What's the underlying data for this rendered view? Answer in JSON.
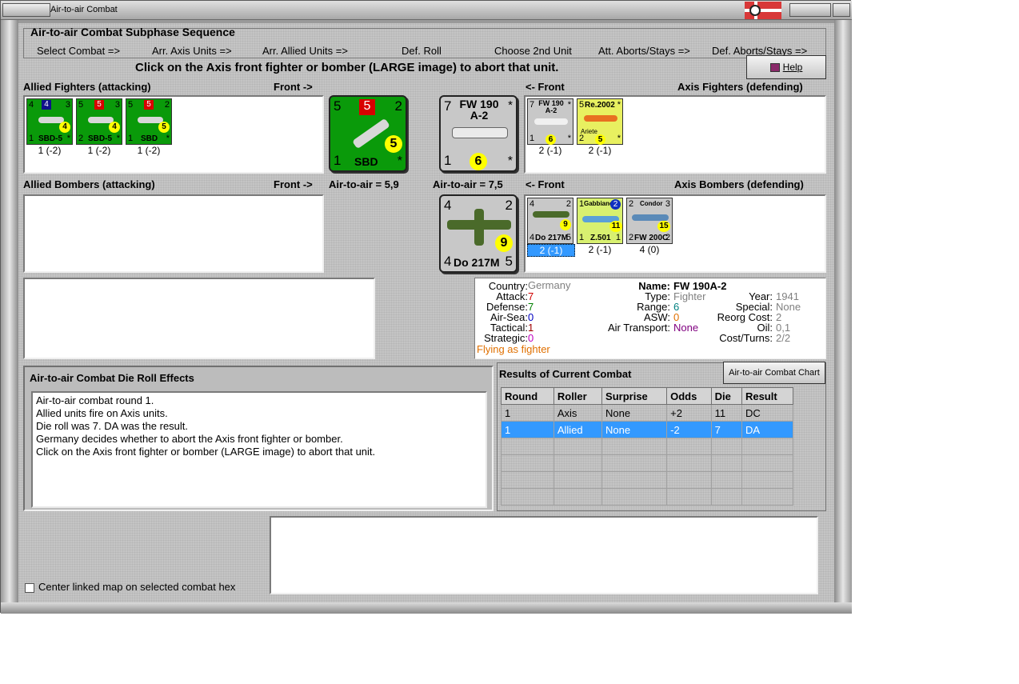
{
  "window": {
    "title": "Air-to-air Combat"
  },
  "sequence": {
    "title": "Air-to-air Combat Subphase Sequence",
    "steps": [
      "Select Combat =>",
      "Arr. Axis Units =>",
      "Arr. Allied Units =>",
      "Def. Roll",
      "Choose 2nd Unit",
      "Att. Aborts/Stays =>",
      "Def. Aborts/Stays =>"
    ]
  },
  "instruction": "Click on the Axis front fighter or bomber  (LARGE image) to abort that unit.",
  "help_label": "Help",
  "allied_fighters": {
    "title": "Allied Fighters (attacking)",
    "front": "Front ->",
    "units": [
      {
        "name": "SBD-5",
        "tl": "4",
        "tr": "3",
        "badge": "4",
        "bl": "1",
        "br": "*",
        "val": "4",
        "caption": "1 (-2)"
      },
      {
        "name": "SBD-5",
        "tl": "5",
        "tr": "3",
        "badge": "5",
        "bl": "2",
        "br": "*",
        "val": "4",
        "caption": "1 (-2)"
      },
      {
        "name": "SBD",
        "tl": "5",
        "tr": "2",
        "badge": "5",
        "bl": "1",
        "br": "*",
        "val": "5",
        "caption": "1 (-2)"
      }
    ]
  },
  "allied_bombers": {
    "title": "Allied Bombers (attacking)",
    "front": "Front ->"
  },
  "allied_big": {
    "tl": "5",
    "badge": "5",
    "tr": "2",
    "bl": "1",
    "name": "SBD",
    "val": "5",
    "br": "*"
  },
  "allied_a2a": "Air-to-air = 5,9",
  "axis_big_fighter": {
    "tl": "7",
    "name1": "FW 190",
    "name2": "A-2",
    "tr": "*",
    "bl": "1",
    "val": "6",
    "br": "*"
  },
  "axis_a2a": "Air-to-air = 7,5",
  "axis_big_bomber": {
    "tl": "4",
    "tr": "2",
    "val": "9",
    "bl": "4",
    "name": "Do 217M",
    "br": "5"
  },
  "axis_fighters": {
    "title": "Axis Fighters (defending)",
    "front": "<- Front",
    "units": [
      {
        "tl": "7",
        "name": "FW 190 A-2",
        "tr": "*",
        "bl": "1",
        "val": "6",
        "br": "*",
        "caption": "2 (-1)"
      },
      {
        "tl": "5",
        "name": "Re.2002",
        "sub": "Ariete",
        "tr": "*",
        "bl": "2",
        "val": "5",
        "br": "*",
        "caption": "2 (-1)"
      }
    ]
  },
  "axis_bombers": {
    "title": "Axis Bombers (defending)",
    "front": "<- Front",
    "units": [
      {
        "tl": "4",
        "tr": "2",
        "val": "9",
        "bl": "4",
        "name": "Do 217M",
        "br": "5",
        "caption": "2 (-1)"
      },
      {
        "tl": "1",
        "name": "Gabbiano",
        "badge": "2",
        "val": "11",
        "bl": "1",
        "bname": "Z.501",
        "br": "1",
        "caption": "2 (-1)"
      },
      {
        "tl": "2",
        "name": "Condor",
        "tr": "3",
        "val": "15",
        "bl": "2",
        "bname": "FW 200C",
        "br": "2",
        "caption": "4 (0)"
      }
    ]
  },
  "unit_info": {
    "country_label": "Country:",
    "country": "Germany",
    "attack_label": "Attack:",
    "attack": "7",
    "defense_label": "Defense:",
    "defense": "7",
    "airsea_label": "Air-Sea:",
    "airsea": "0",
    "tactical_label": "Tactical:",
    "tactical": "1",
    "strategic_label": "Strategic:",
    "strategic": "0",
    "flying": "Flying as fighter",
    "name_label": "Name:",
    "name": "FW 190A-2",
    "type_label": "Type:",
    "type": "Fighter",
    "range_label": "Range:",
    "range": "6",
    "asw_label": "ASW:",
    "asw": "0",
    "transport_label": "Air Transport:",
    "transport": "None",
    "year_label": "Year:",
    "year": "1941",
    "special_label": "Special:",
    "special": "None",
    "reorg_label": "Reorg Cost:",
    "reorg": "2",
    "oil_label": "Oil:",
    "oil": "0,1",
    "cost_label": "Cost/Turns:",
    "cost": "2/2"
  },
  "die_effects": {
    "title": "Air-to-air Combat Die Roll Effects",
    "lines": [
      "Air-to-air combat round 1.",
      "Allied units fire on Axis units.",
      "Die roll was 7.  DA was the result.",
      "Germany decides whether to abort the Axis front fighter or bomber.",
      "Click on the Axis front fighter or bomber  (LARGE image) to abort that unit."
    ]
  },
  "results": {
    "title": "Results of Current Combat",
    "chart_button": "Air-to-air Combat Chart",
    "headers": [
      "Round",
      "Roller",
      "Surprise",
      "Odds",
      "Die",
      "Result"
    ],
    "rows": [
      [
        "1",
        "Axis",
        "None",
        "+2",
        "11",
        "DC"
      ],
      [
        "1",
        "Allied",
        "None",
        "-2",
        "7",
        "DA"
      ]
    ]
  },
  "center_map_label": "Center linked map on selected combat hex"
}
